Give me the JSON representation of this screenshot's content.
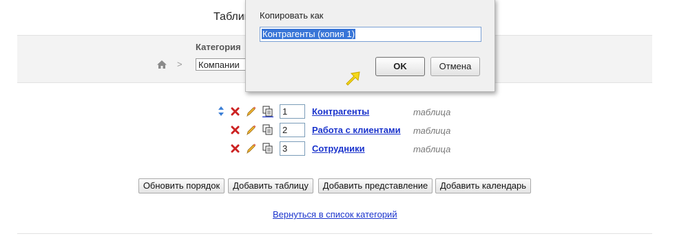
{
  "header": {
    "title": "Таблиц"
  },
  "category": {
    "label": "Категория",
    "selected": "Компании",
    "separator": ">"
  },
  "rows": [
    {
      "order": "1",
      "name": "Контрагенты",
      "type": "таблица"
    },
    {
      "order": "2",
      "name": "Работа с клиентами",
      "type": "таблица"
    },
    {
      "order": "3",
      "name": "Сотрудники",
      "type": "таблица"
    }
  ],
  "buttons": {
    "update_order": "Обновить порядок",
    "add_table": "Добавить таблицу",
    "add_view": "Добавить представление",
    "add_calendar": "Добавить календарь"
  },
  "back_link": "Вернуться в список категорий",
  "dialog": {
    "label": "Копировать как",
    "value": "Контрагенты (копия 1)",
    "ok": "OK",
    "cancel": "Отмена"
  },
  "colors": {
    "link": "#1a33cc",
    "delete": "#cc2222",
    "highlight": "#3875d7",
    "cursor": "#f5d81a"
  }
}
